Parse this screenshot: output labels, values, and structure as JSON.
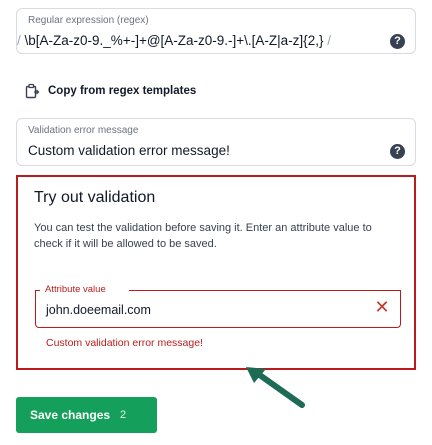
{
  "regex_field": {
    "label": "Regular expression (regex)",
    "delimiter_open": "/",
    "value": "\\b[A-Za-z0-9._%+-]+@[A-Za-z0-9.-]+\\.[A-Z|a-z]{2,}",
    "delimiter_close": "/",
    "help_icon": "question-circle-icon"
  },
  "copy_templates": {
    "label": "Copy from regex templates",
    "icon": "copy-icon"
  },
  "error_message_field": {
    "label": "Validation error message",
    "value": "Custom validation error message!",
    "help_icon": "question-circle-icon"
  },
  "try_out": {
    "title": "Try out validation",
    "description": "You can test the validation before saving it. Enter an attribute value to check if it will be allowed to be saved.",
    "attribute_field": {
      "label": "Attribute value",
      "value": "john.doeemail.com",
      "clear_icon": "close-icon"
    },
    "error_text": "Custom validation error message!"
  },
  "save_button": {
    "label": "Save changes",
    "count": "2"
  },
  "colors": {
    "error": "#b91c1c",
    "save_green": "#14a05a",
    "arrow": "#1d6b55"
  }
}
